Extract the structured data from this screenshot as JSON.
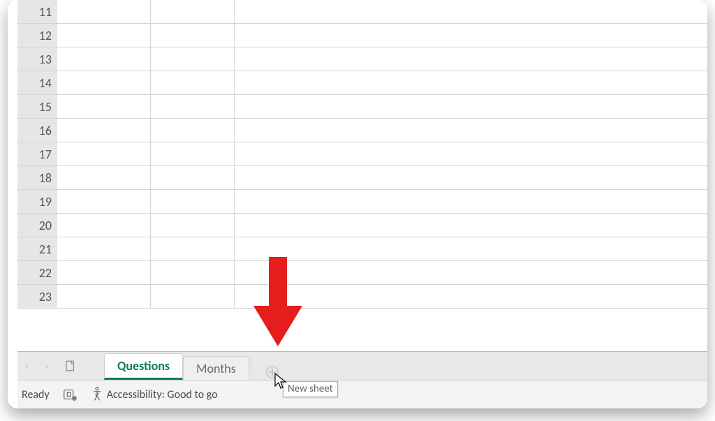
{
  "row_headers": [
    "11",
    "12",
    "13",
    "14",
    "15",
    "16",
    "17",
    "18",
    "19",
    "20",
    "21",
    "22",
    "23"
  ],
  "sheet_nav": {
    "prev": "‹",
    "next": "›"
  },
  "tabs": {
    "active": "Questions",
    "items": [
      {
        "label": "Questions",
        "active": true
      },
      {
        "label": "Months",
        "active": false
      }
    ]
  },
  "new_sheet_tooltip": "New sheet",
  "status": {
    "ready": "Ready",
    "accessibility": "Accessibility: Good to go"
  },
  "annotation": {
    "color": "#e51d1d"
  }
}
